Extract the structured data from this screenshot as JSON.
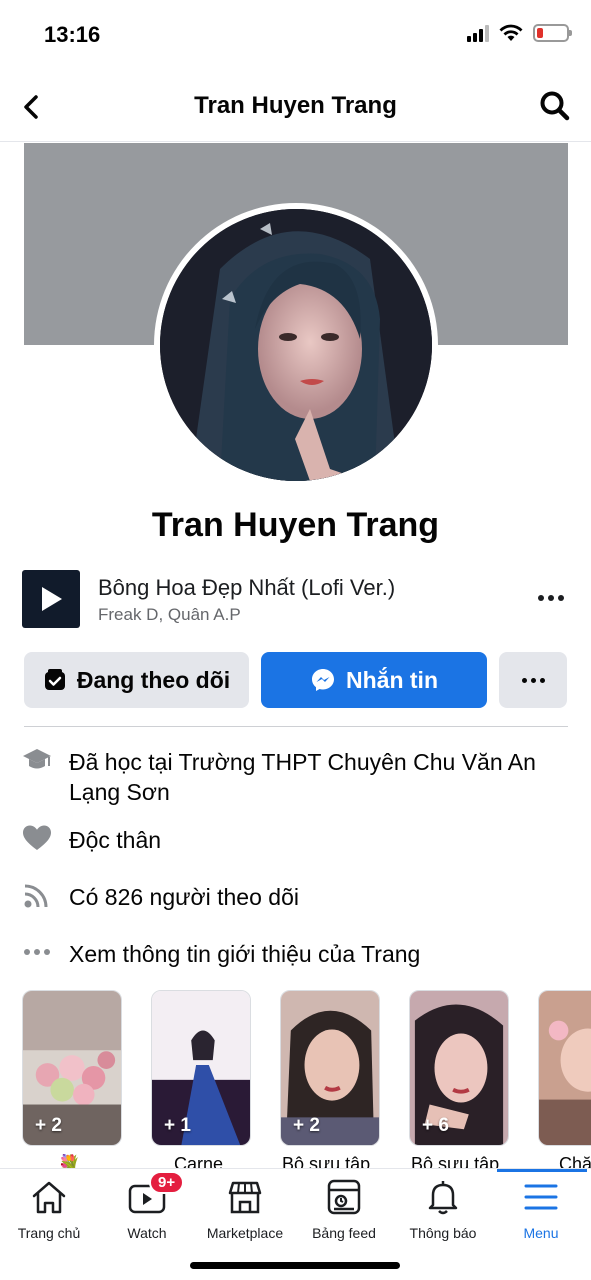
{
  "status_bar": {
    "time": "13:16"
  },
  "header": {
    "title": "Tran Huyen Trang"
  },
  "profile": {
    "name": "Tran Huyen Trang"
  },
  "music": {
    "title": "Bông Hoa Đẹp Nhất (Lofi Ver.)",
    "artist": "Freak D, Quân A.P"
  },
  "actions": {
    "follow_label": "Đang theo dõi",
    "message_label": "Nhắn tin"
  },
  "intro": [
    {
      "icon": "graduation-cap-icon",
      "text": "Đã học tại Trường THPT Chuyên Chu Văn An Lạng Sơn"
    },
    {
      "icon": "heart-icon",
      "text": "Độc thân"
    },
    {
      "icon": "rss-feed-icon",
      "text": "Có 826 người theo dõi"
    },
    {
      "icon": "more-dots-icon",
      "text": "Xem thông tin giới thiệu của Trang"
    }
  ],
  "featured": [
    {
      "count": "+ 2",
      "label": "💐"
    },
    {
      "count": "+ 1",
      "label": "Carne"
    },
    {
      "count": "+ 2",
      "label": "Bộ sưu tập"
    },
    {
      "count": "+ 6",
      "label": "Bộ sưu tập"
    },
    {
      "count": "",
      "label": "Chă"
    }
  ],
  "tabbar": {
    "items": [
      {
        "label": "Trang chủ"
      },
      {
        "label": "Watch",
        "badge": "9+"
      },
      {
        "label": "Marketplace"
      },
      {
        "label": "Bảng feed"
      },
      {
        "label": "Thông báo"
      },
      {
        "label": "Menu",
        "active": true
      }
    ]
  },
  "colors": {
    "accent": "#1b74e4",
    "badge": "#e41e3f",
    "cover": "#979a9e"
  }
}
